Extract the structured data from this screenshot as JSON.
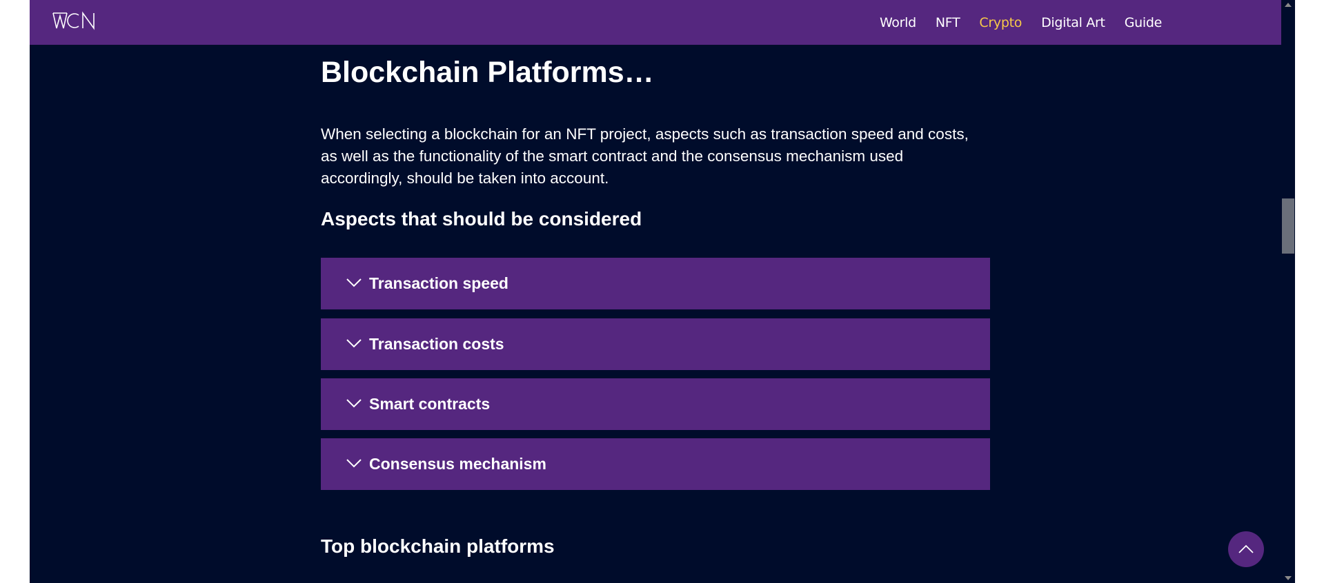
{
  "navbar": {
    "logo_text": "WCN",
    "links": [
      {
        "label": "World",
        "active": false
      },
      {
        "label": "NFT",
        "active": false
      },
      {
        "label": "Crypto",
        "active": true
      },
      {
        "label": "Digital Art",
        "active": false
      },
      {
        "label": "Guide",
        "active": false
      }
    ]
  },
  "main": {
    "title": "Blockchain Platforms…",
    "intro": "When selecting a blockchain for an NFT project, aspects such as transaction speed and costs, as well as the functionality of the smart contract and the consensus mechanism used accordingly, should be taken into account.",
    "aspects_heading": "Aspects that should be considered",
    "accordion": [
      {
        "label": "Transaction speed",
        "icon": "chevron-down-icon"
      },
      {
        "label": "Transaction costs",
        "icon": "chevron-down-icon"
      },
      {
        "label": "Smart contracts",
        "icon": "chevron-down-icon"
      },
      {
        "label": "Consensus mechanism",
        "icon": "chevron-down-icon"
      }
    ],
    "top_heading": "Top blockchain platforms"
  },
  "scroll_top": {
    "icon": "chevron-up-icon"
  },
  "colors": {
    "background": "#000c2b",
    "brand_purple": "#55277f",
    "active_link": "#f7c948",
    "text": "#ffffff"
  }
}
